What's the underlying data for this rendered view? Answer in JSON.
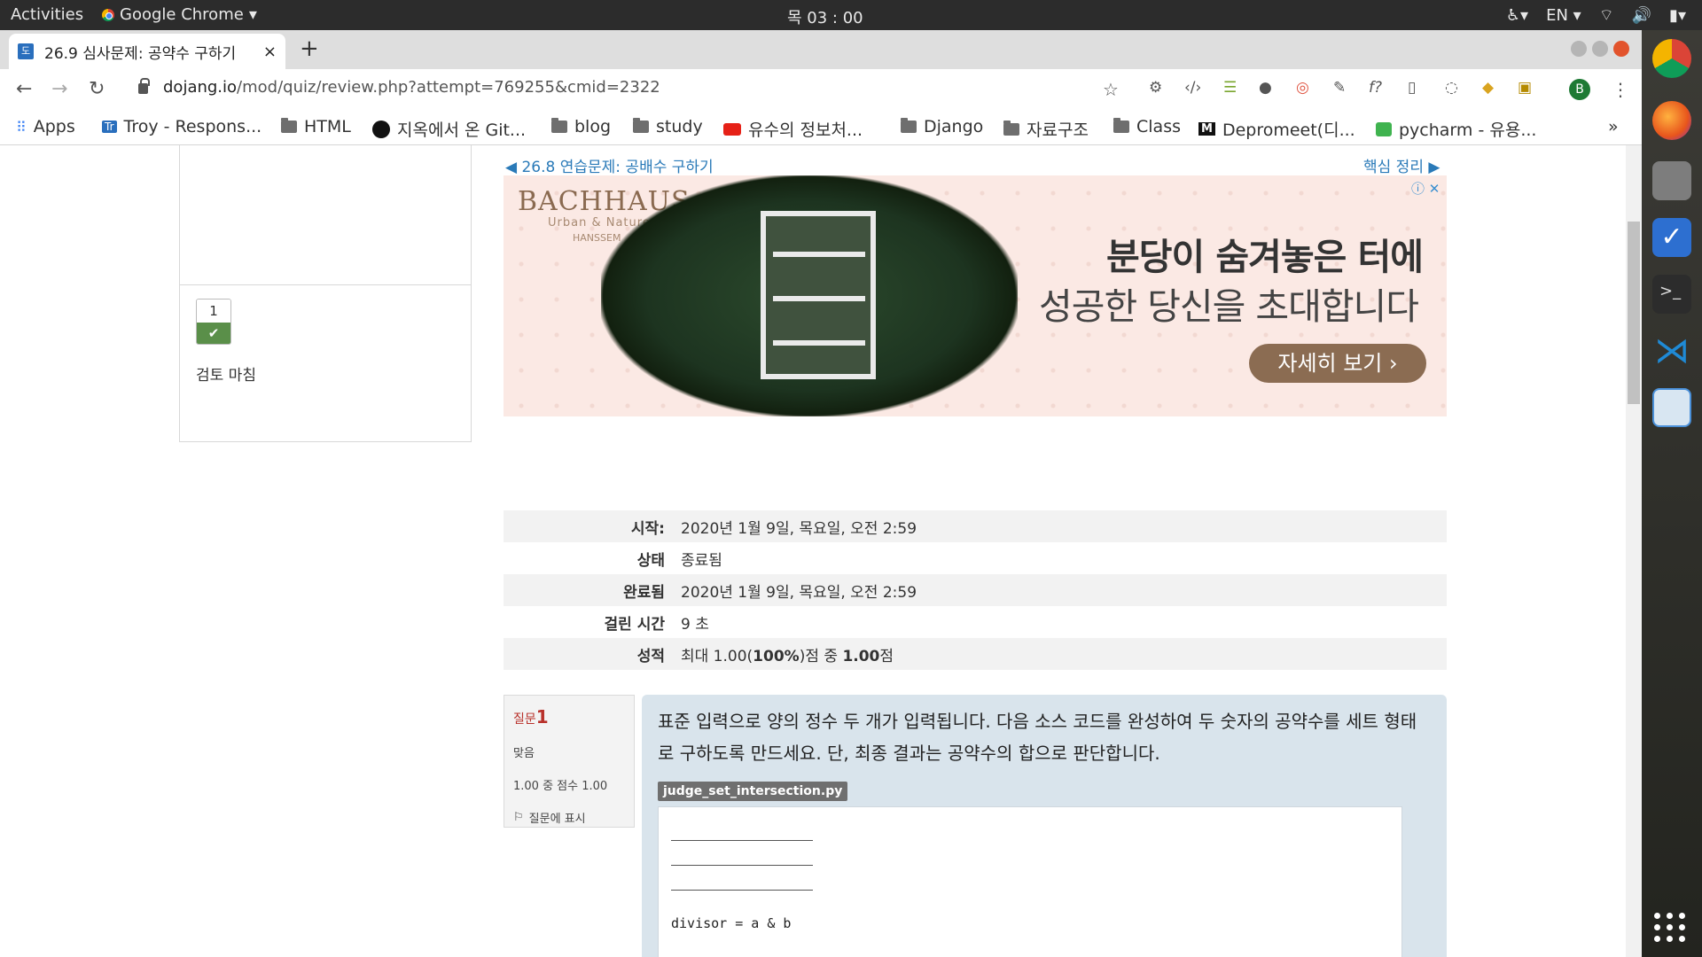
{
  "os": {
    "activities": "Activities",
    "app_name": "Google Chrome",
    "clock": "목 03 : 00",
    "lang": "EN"
  },
  "browser": {
    "tab_title": "26.9 심사문제: 공약수 구하기",
    "url_host": "dojang.io",
    "url_path": "/mod/quiz/review.php?attempt=769255&cmid=2322",
    "profile_initial": "B",
    "bookmarks": [
      {
        "label": "Apps",
        "icon": "apps-grid-icon"
      },
      {
        "label": "Troy - Respons...",
        "icon": "trello-icon"
      },
      {
        "label": "HTML",
        "icon": "folder-icon"
      },
      {
        "label": "지옥에서 온 Git...",
        "icon": "github-icon"
      },
      {
        "label": "blog",
        "icon": "folder-icon"
      },
      {
        "label": "study",
        "icon": "folder-icon"
      },
      {
        "label": "유수의 정보처...",
        "icon": "youtube-icon"
      },
      {
        "label": "Django",
        "icon": "folder-icon"
      },
      {
        "label": "자료구조",
        "icon": "folder-icon"
      },
      {
        "label": "Class",
        "icon": "folder-icon"
      },
      {
        "label": "Depromeet(디...",
        "icon": "medium-icon"
      },
      {
        "label": "pycharm - 유용...",
        "icon": "chat-icon"
      }
    ],
    "more": "»"
  },
  "quiz_nav": {
    "question_number": "1",
    "finish_review": "검토 마침"
  },
  "links": {
    "prev": "◀ 26.8 연습문제: 공배수 구하기",
    "next": "핵심 정리 ▶"
  },
  "ad": {
    "brand": "BACHHAUS",
    "brand_sub": "Urban & Nature",
    "brand_sub2": "HANSSEM",
    "headline1": "분당이 숨겨놓은 터에",
    "headline2": "성공한 당신을 초대합니다",
    "cta": "자세히 보기 ›"
  },
  "summary": [
    {
      "label": "시작:",
      "value": "2020년 1월 9일, 목요일, 오전 2:59"
    },
    {
      "label": "상태",
      "value": "종료됨"
    },
    {
      "label": "완료됨",
      "value": "2020년 1월 9일, 목요일, 오전 2:59"
    },
    {
      "label": "걸린 시간",
      "value": "9 초"
    },
    {
      "label": "성적",
      "value_pre": "최대 1.00(",
      "value_bold1": "100%",
      "value_mid": ")점 중 ",
      "value_bold2": "1.00",
      "value_post": "점"
    }
  ],
  "question": {
    "label": "질문",
    "number": "1",
    "status": "맞음",
    "mark": "1.00 중 점수 1.00",
    "flag_label": "질문에 표시",
    "prompt": "표준 입력으로 양의 정수 두 개가 입력됩니다. 다음 소스 코드를 완성하여 두 숫자의 공약수를 세트 형태로 구하도록 만드세요. 단, 최종 결과는 공약수의 합으로 판단합니다.",
    "filename": "judge_set_intersection.py",
    "code_line": "divisor = a & b"
  }
}
